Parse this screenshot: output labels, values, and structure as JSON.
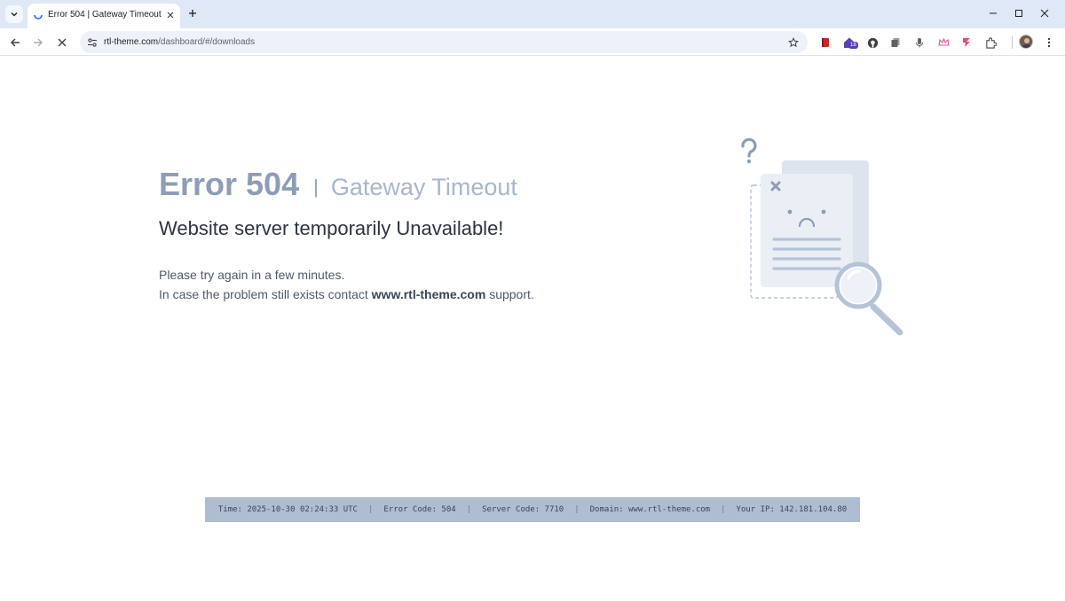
{
  "browser": {
    "tab_title": "Error 504  | Gateway Timeout",
    "url_host": "rtl-theme.com",
    "url_path": "/dashboard/#/downloads",
    "extension_badge": "18"
  },
  "page": {
    "error_code": "Error 504",
    "divider": "|",
    "error_name": "Gateway Timeout",
    "subtitle": "Website server temporarily Unavailable!",
    "message_line1": "Please try again in a few minutes.",
    "message_line2_prefix": "In case the problem still exists contact",
    "message_line2_link": "www.rtl-theme.com",
    "message_line2_suffix": "support."
  },
  "footer": {
    "time": "Time: 2025-10-30 02:24:33 UTC",
    "error_code": "Error Code: 504",
    "server_code": "Server Code: 7710",
    "domain": "Domain: www.rtl-theme.com",
    "ip": "Your IP: 142.181.104.80"
  },
  "colors": {
    "accent": "#8e9db6",
    "footer_bg": "#aebdd1",
    "chrome_bg": "#dfe8f6"
  }
}
